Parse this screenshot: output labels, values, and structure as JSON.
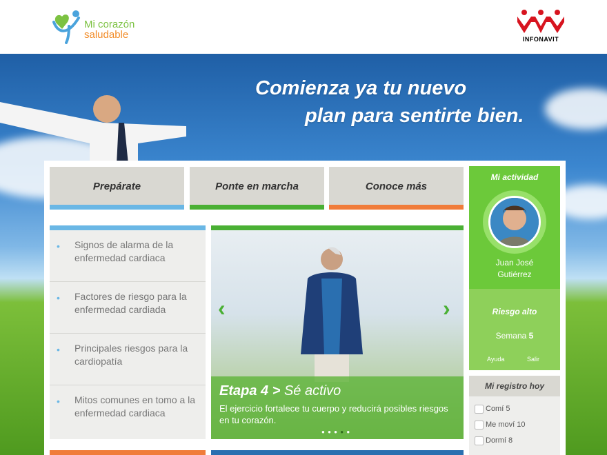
{
  "header": {
    "logo_line1": "Mi corazón",
    "logo_line2": "saludable",
    "partner_name": "INFONAVIT"
  },
  "hero": {
    "title_line1": "Comienza ya tu nuevo",
    "title_line2": "plan para sentirte bien."
  },
  "tabs": [
    {
      "label": "Prepárate",
      "color": "#6ab7e5"
    },
    {
      "label": "Ponte en marcha",
      "color": "#4ab034"
    },
    {
      "label": "Conoce más",
      "color": "#f07c3a"
    }
  ],
  "topics": [
    {
      "label": "Signos de alarma de la enfermedad cardiaca"
    },
    {
      "label": "Factores de riesgo para la enfermedad cardiada"
    },
    {
      "label": "Principales riesgos para la cardiopatía"
    },
    {
      "label": "Mitos comunes en tomo a la enfermedad cardiaca"
    }
  ],
  "carousel": {
    "stage": "Etapa 4 >",
    "stage_name": "Sé activo",
    "text": "El ejercicio fortalece tu cuerpo y reducirá posibles riesgos en tu corazón.",
    "slide_count": 5,
    "active_slide": 4
  },
  "activity": {
    "title": "Mi actividad",
    "user_first": "Juan José",
    "user_last": "Gutiérrez",
    "risk": "Riesgo alto",
    "week_label": "Semana",
    "week_value": "5",
    "help": "Ayuda",
    "logout": "Salir"
  },
  "registry": {
    "title": "Mi registro hoy",
    "items": [
      {
        "label": "Comí 5"
      },
      {
        "label": "Me moví 10"
      },
      {
        "label": "Dormí 8"
      }
    ]
  },
  "colors": {
    "brand_green": "#6cc93a",
    "brand_blue": "#6ab7e5",
    "brand_orange": "#f07c3a"
  }
}
